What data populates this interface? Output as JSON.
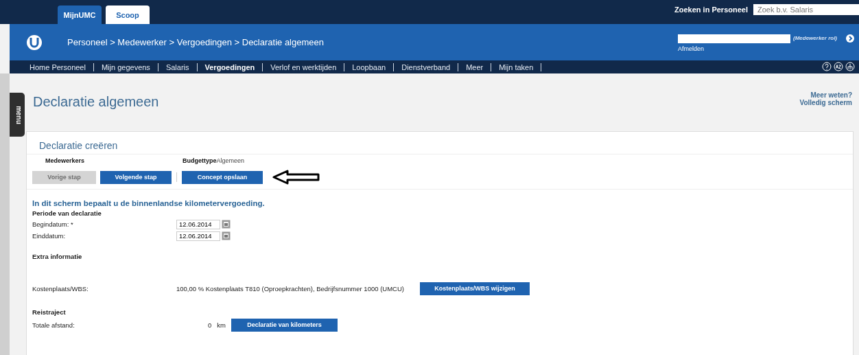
{
  "tabs": [
    {
      "label": "MijnUMC",
      "selected": true
    },
    {
      "label": "Scoop",
      "selected": false
    }
  ],
  "search": {
    "label": "Zoeken in Personeel",
    "placeholder": "Zoek b.v. Salaris"
  },
  "breadcrumb": "Personeel > Medewerker > Vergoedingen > Declaratie algemeen",
  "role": {
    "label": "(Medewerker rol)",
    "logout": "Afmelden"
  },
  "nav": [
    {
      "label": "Home Personeel",
      "selected": false
    },
    {
      "label": "Mijn gegevens",
      "selected": false
    },
    {
      "label": "Salaris",
      "selected": false
    },
    {
      "label": "Vergoedingen",
      "selected": true
    },
    {
      "label": "Verlof en werktijden",
      "selected": false
    },
    {
      "label": "Loopbaan",
      "selected": false
    },
    {
      "label": "Dienstverband",
      "selected": false
    },
    {
      "label": "Meer",
      "selected": false
    },
    {
      "label": "Mijn taken",
      "selected": false
    }
  ],
  "menu_tab": "menu",
  "page_title": "Declaratie algemeen",
  "side_links": [
    "Meer weten?",
    "Volledig scherm"
  ],
  "section_title": "Declaratie creëren",
  "info": [
    {
      "label": "Medewerkers"
    },
    {
      "label": "Budgettype",
      "value": "Algemeen"
    }
  ],
  "steps": [
    {
      "label": "Vorige stap",
      "disabled": true
    },
    {
      "label": "Volgende stap",
      "disabled": false
    },
    {
      "label": "Concept opslaan",
      "disabled": false
    }
  ],
  "intro": "In dit scherm bepaalt u de binnenlandse kilometervergoeding.",
  "period_heading": "Periode van declaratie",
  "dates": [
    {
      "label": "Begindatum: *",
      "value": "12.06.2014"
    },
    {
      "label": "Einddatum:",
      "value": "12.06.2014"
    }
  ],
  "extra_heading": "Extra informatie",
  "cost": {
    "label": "Kostenplaats/WBS:",
    "value": "100,00 % Kostenplaats T810 (Oproepkrachten), Bedrijfsnummer 1000 (UMCU)",
    "button": "Kostenplaats/WBS wijzigen"
  },
  "trip_heading": "Reistraject",
  "distance": {
    "label": "Totale afstand:",
    "value": "0",
    "unit": "km",
    "button": "Declaratie van kilometers"
  }
}
